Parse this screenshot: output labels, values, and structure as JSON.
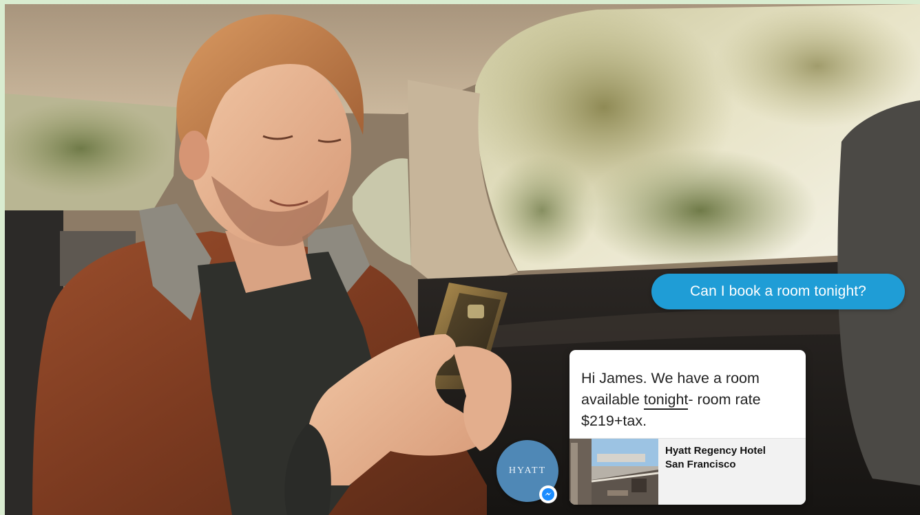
{
  "chat": {
    "outgoing": "Can I book a room tonight?",
    "incoming": {
      "text_before": "Hi James. We have a room available ",
      "text_underlined": "tonight",
      "text_after": "- room rate $219+tax.",
      "card": {
        "hotel_line1": "Hyatt Regency Hotel",
        "hotel_line2": "San Francisco"
      }
    },
    "sender": {
      "avatar_logo": "HYATT",
      "avatar_icon": "messenger-icon"
    }
  },
  "colors": {
    "outgoing_bubble": "#1f9dd6",
    "avatar_bg": "#4f88b6",
    "messenger_badge": "#1a8cff",
    "page_border": "#d9ecd0"
  }
}
